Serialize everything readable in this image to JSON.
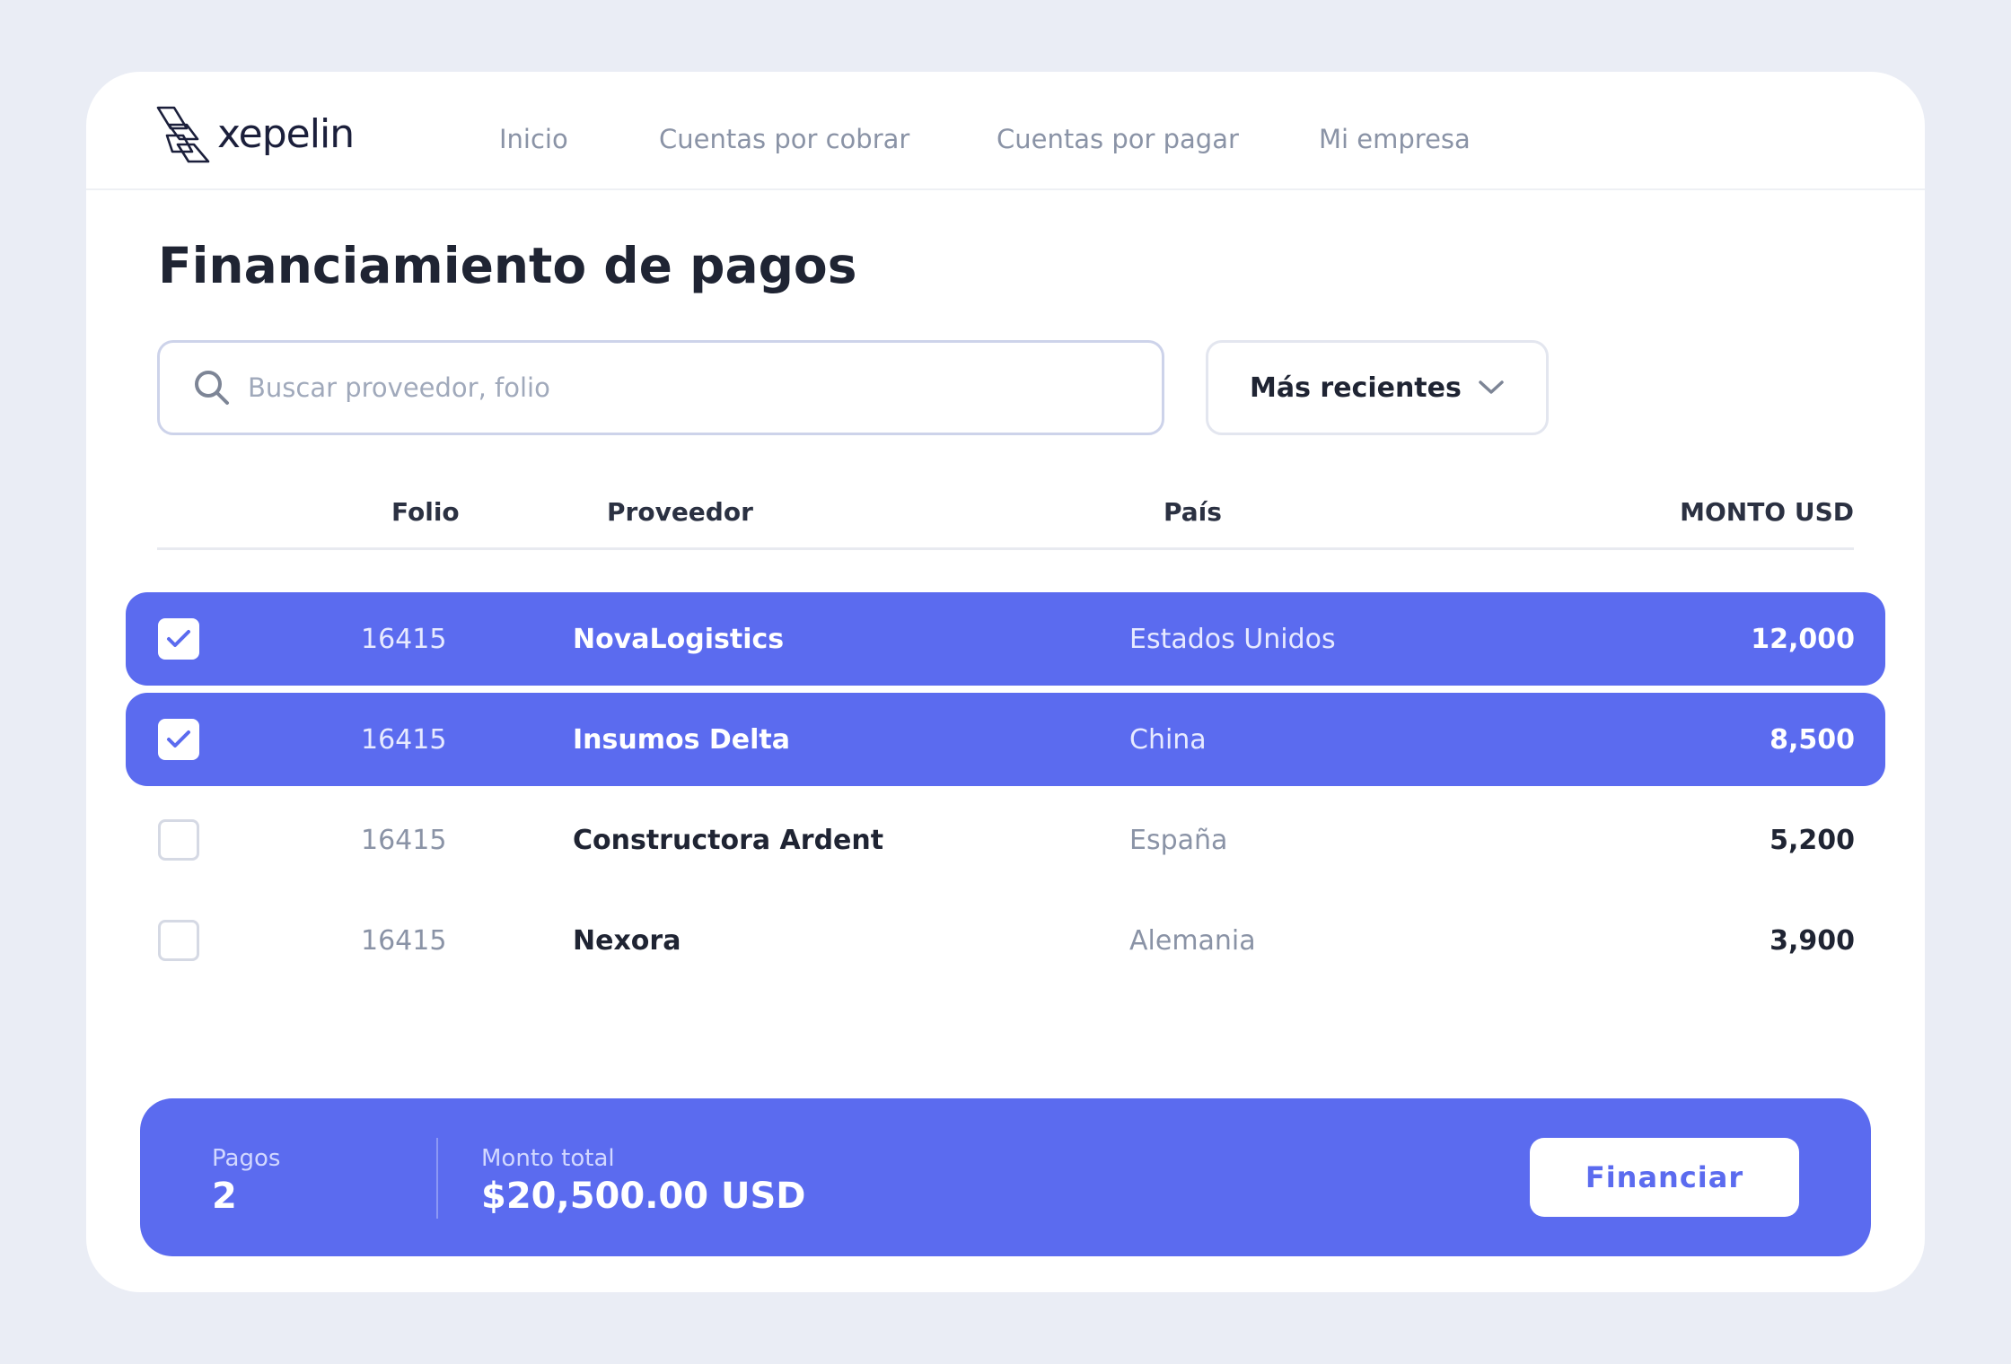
{
  "brand": {
    "name": "xepelin"
  },
  "nav": [
    {
      "label": "Inicio"
    },
    {
      "label": "Cuentas por cobrar"
    },
    {
      "label": "Cuentas por pagar"
    },
    {
      "label": "Mi empresa"
    }
  ],
  "page": {
    "title": "Financiamiento de pagos"
  },
  "search": {
    "placeholder": "Buscar proveedor, folio",
    "value": ""
  },
  "sort": {
    "selected": "Más recientes"
  },
  "table": {
    "columns": {
      "folio": "Folio",
      "proveedor": "Proveedor",
      "pais": "País",
      "monto": "MONTO USD"
    },
    "rows": [
      {
        "selected": true,
        "folio": "16415",
        "proveedor": "NovaLogistics",
        "pais": "Estados Unidos",
        "monto": "12,000"
      },
      {
        "selected": true,
        "folio": "16415",
        "proveedor": "Insumos Delta",
        "pais": "China",
        "monto": "8,500"
      },
      {
        "selected": false,
        "folio": "16415",
        "proveedor": "Constructora Ardent",
        "pais": "España",
        "monto": "5,200"
      },
      {
        "selected": false,
        "folio": "16415",
        "proveedor": "Nexora",
        "pais": "Alemania",
        "monto": "3,900"
      }
    ]
  },
  "summary": {
    "pagos_label": "Pagos",
    "pagos_value": "2",
    "monto_label": "Monto total",
    "monto_value": "$20,500.00 USD",
    "action_label": "Financiar"
  },
  "colors": {
    "accent": "#5b6bef",
    "background": "#eaedf5",
    "text": "#1f2433",
    "muted": "#8a93a6"
  },
  "icons": {
    "search": "search-icon",
    "sort": "chevron-down-icon",
    "check": "check-icon"
  }
}
